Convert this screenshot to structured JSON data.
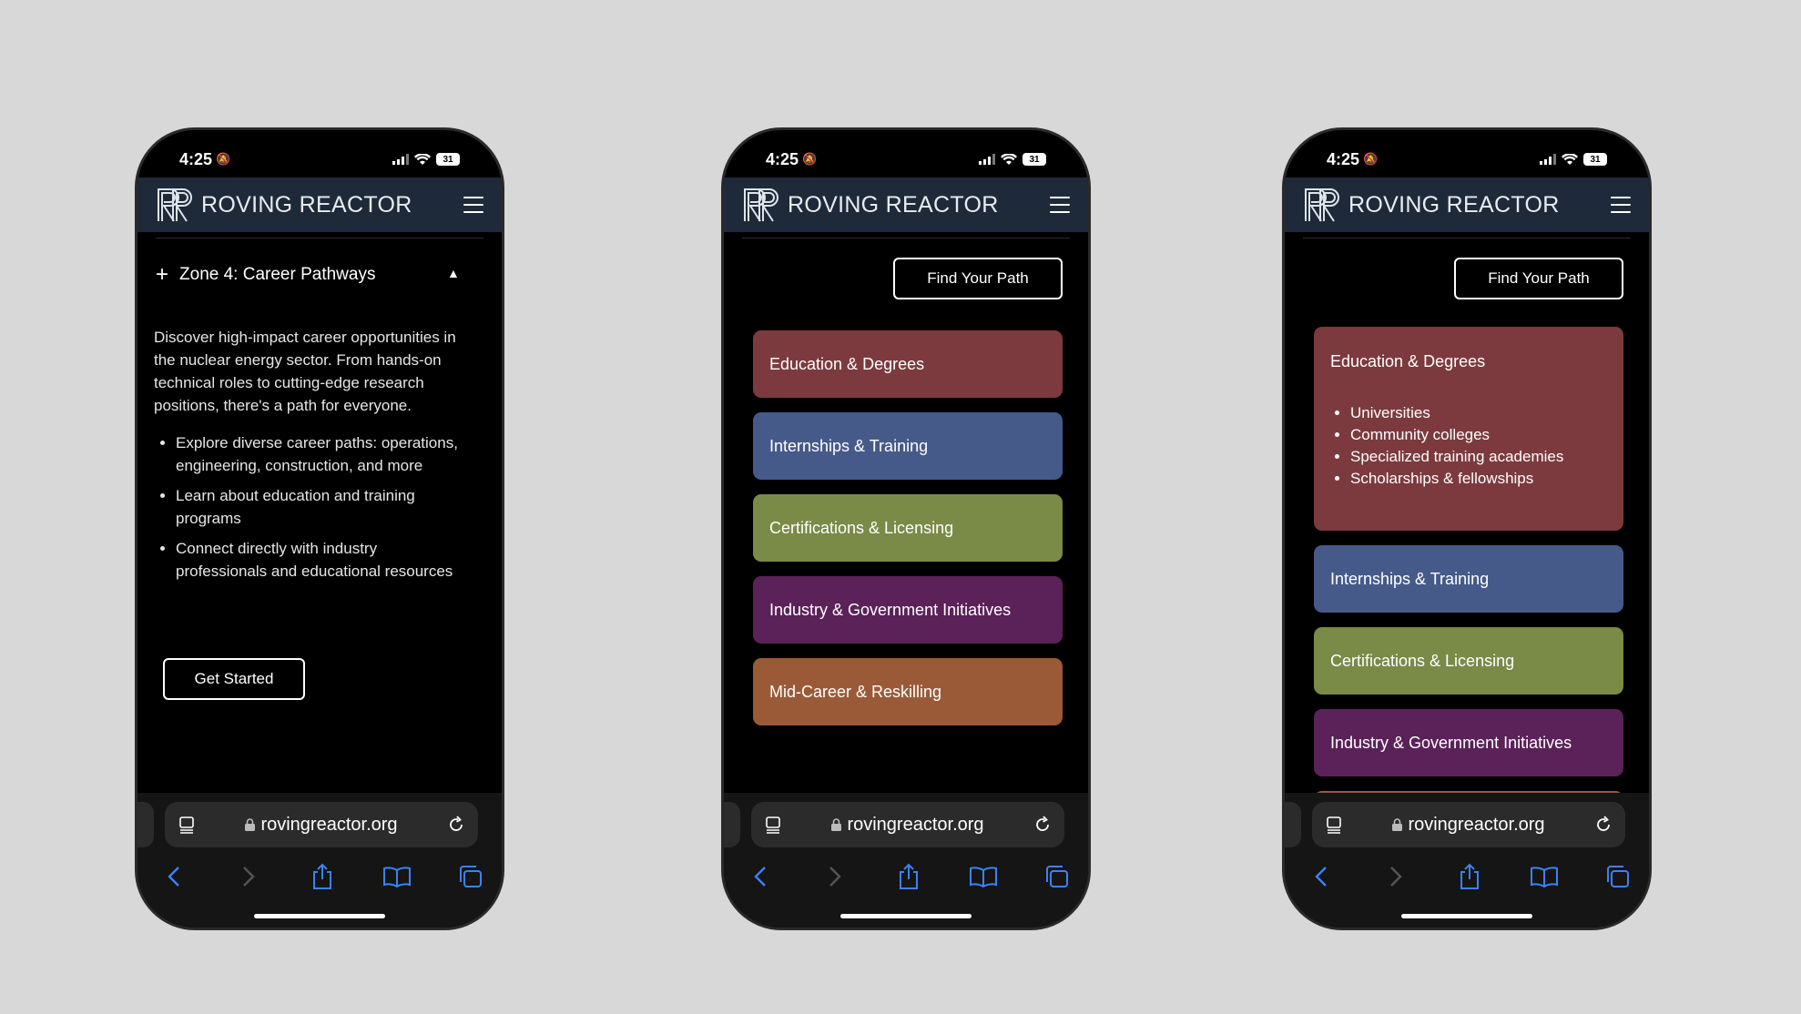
{
  "status": {
    "time": "4:25",
    "battery": "31"
  },
  "brand": {
    "name": "ROVING REACTOR"
  },
  "zone": {
    "title": "Zone 4: Career Pathways",
    "description": "Discover high-impact career opportunities in the nuclear energy sector. From hands-on technical roles to cutting-edge research positions, there's a path for everyone.",
    "bullets": [
      "Explore diverse career paths: operations, engineering, construction, and more",
      "Learn about education and training programs",
      "Connect directly with industry professionals and educational resources"
    ],
    "cta": "Get Started"
  },
  "paths": {
    "find_button": "Find Your Path",
    "cards": [
      {
        "label": "Education & Degrees",
        "color": "#7c3a3e"
      },
      {
        "label": "Internships & Training",
        "color": "#465a8a"
      },
      {
        "label": "Certifications & Licensing",
        "color": "#7a8a47"
      },
      {
        "label": "Industry & Government Initiatives",
        "color": "#5a2258"
      },
      {
        "label": "Mid-Career & Reskilling",
        "color": "#9a5a38"
      }
    ],
    "education_items": [
      "Universities",
      "Community colleges",
      "Specialized training academies",
      "Scholarships & fellowships"
    ]
  },
  "browser": {
    "url": "rovingreactor.org"
  },
  "colors": {
    "header_bg": "#1e2a3a",
    "accent_blue": "#3b82f6"
  }
}
